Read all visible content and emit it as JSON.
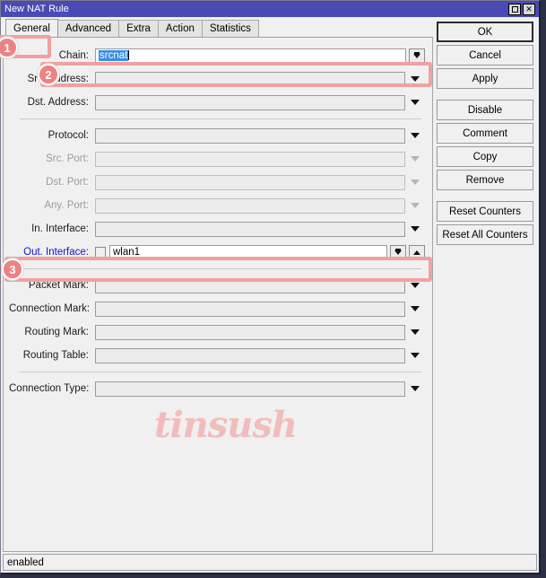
{
  "window": {
    "title": "New NAT Rule",
    "controls": [
      {
        "name": "maximize",
        "glyph": "□"
      },
      {
        "name": "close",
        "glyph": "✕"
      }
    ]
  },
  "tabs": [
    {
      "label": "General",
      "active": true
    },
    {
      "label": "Advanced",
      "active": false
    },
    {
      "label": "Extra",
      "active": false
    },
    {
      "label": "Action",
      "active": false
    },
    {
      "label": "Statistics",
      "active": false
    }
  ],
  "form": {
    "chain": {
      "label": "Chain:",
      "value": "srcnat",
      "selected": true
    },
    "src_address": {
      "label": "Src. Address:",
      "value": ""
    },
    "dst_address": {
      "label": "Dst. Address:",
      "value": ""
    },
    "protocol": {
      "label": "Protocol:",
      "value": ""
    },
    "src_port": {
      "label": "Src. Port:",
      "value": "",
      "disabled": true
    },
    "dst_port": {
      "label": "Dst. Port:",
      "value": "",
      "disabled": true
    },
    "any_port": {
      "label": "Any. Port:",
      "value": "",
      "disabled": true
    },
    "in_interface": {
      "label": "In. Interface:",
      "value": ""
    },
    "out_interface": {
      "label": "Out. Interface:",
      "value": "wlan1",
      "checked": false
    },
    "packet_mark": {
      "label": "Packet Mark:",
      "value": ""
    },
    "connection_mark": {
      "label": "Connection Mark:",
      "value": ""
    },
    "routing_mark": {
      "label": "Routing Mark:",
      "value": ""
    },
    "routing_table": {
      "label": "Routing Table:",
      "value": ""
    },
    "connection_type": {
      "label": "Connection Type:",
      "value": ""
    }
  },
  "buttons": [
    {
      "label": "OK",
      "primary": true
    },
    {
      "label": "Cancel",
      "primary": false
    },
    {
      "label": "Apply",
      "primary": false
    },
    {
      "label": "Disable",
      "primary": false
    },
    {
      "label": "Comment",
      "primary": false
    },
    {
      "label": "Copy",
      "primary": false
    },
    {
      "label": "Remove",
      "primary": false
    },
    {
      "label": "Reset Counters",
      "primary": false
    },
    {
      "label": "Reset All Counters",
      "primary": false
    }
  ],
  "status": {
    "text": "enabled"
  },
  "watermark": {
    "text": "tinsush"
  },
  "annotations": {
    "badge1": "1",
    "badge2": "2",
    "badge3": "3"
  },
  "colors": {
    "titlebar": "#4a4ab4",
    "highlight": "#f2a0a0",
    "badge": "#ee8282",
    "selection": "#3a8ee6",
    "blue_label": "#1414c8",
    "watermark": "#f2b3b3"
  }
}
